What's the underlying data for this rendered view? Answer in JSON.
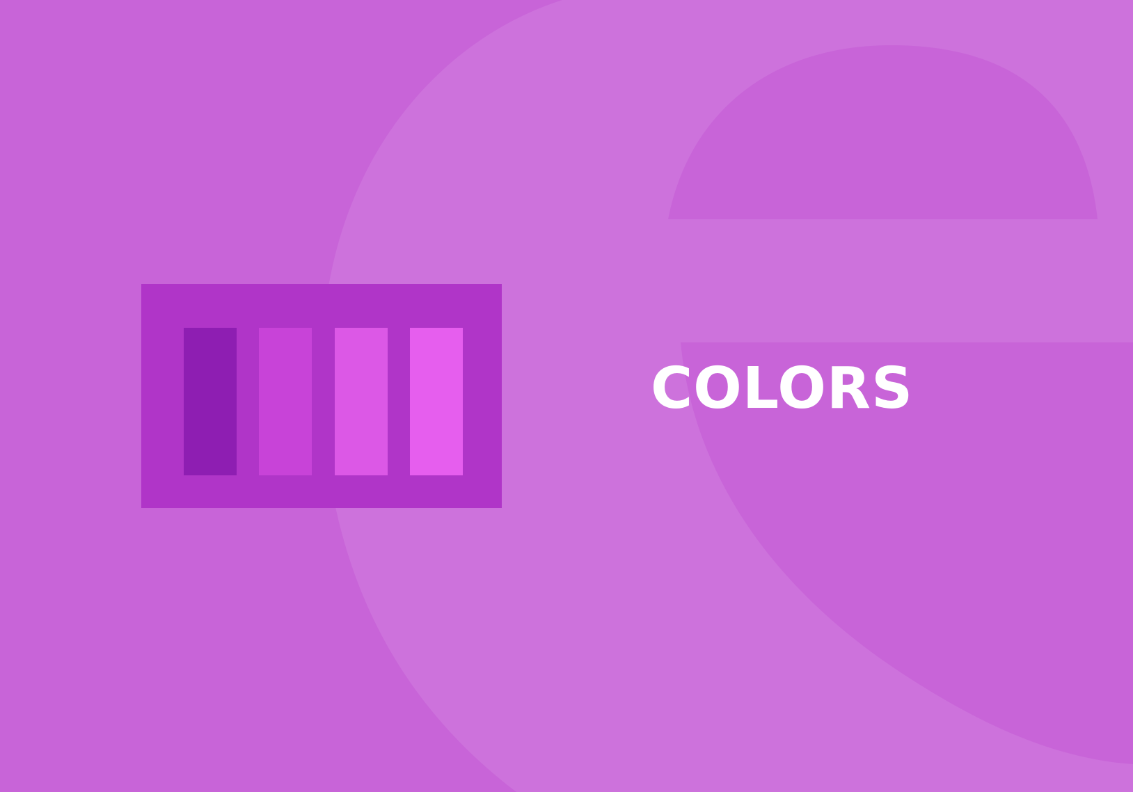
{
  "background": {
    "color": "#c864d8",
    "decoration": "large-letter-e-watermark",
    "decoration_color": "#cd72dc"
  },
  "palette": {
    "frame_color": "#b035c8",
    "swatches": [
      {
        "color": "#8e1eb2"
      },
      {
        "color": "#c843d8"
      },
      {
        "color": "#dc58e6"
      },
      {
        "color": "#e65eee"
      }
    ]
  },
  "title": "COLORS"
}
